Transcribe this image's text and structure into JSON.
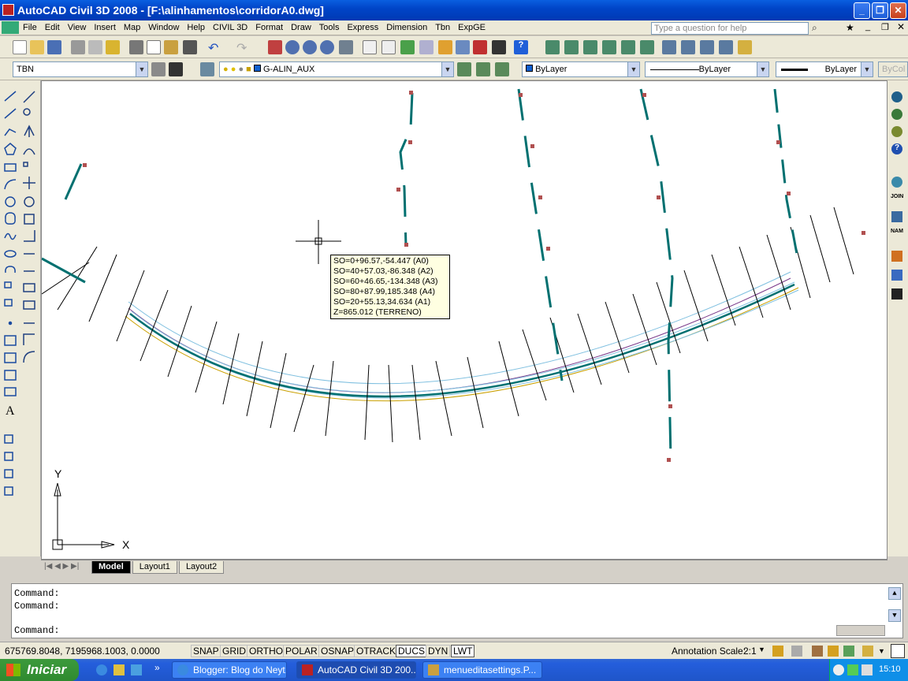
{
  "window": {
    "title": "AutoCAD Civil 3D 2008 - [F:\\alinhamentos\\corridorA0.dwg]"
  },
  "menu": [
    "File",
    "Edit",
    "View",
    "Insert",
    "Map",
    "Window",
    "Help",
    "CIVIL 3D",
    "Format",
    "Draw",
    "Tools",
    "Express",
    "Dimension",
    "Tbn",
    "ExpGE"
  ],
  "help_search": {
    "placeholder": "Type a question for help"
  },
  "properties_bar": {
    "textstyle": "TBN",
    "layer": "G-ALIN_AUX",
    "color": "ByLayer",
    "linetype": "ByLayer",
    "lineweight": "ByLayer",
    "plotstyle": "ByCol"
  },
  "tooltip": {
    "lines": [
      "SO=0+96.57,-54.447 (A0)",
      "SO=40+57.03,-86.348 (A2)",
      "SO=60+46.65,-134.348 (A3)",
      "SO=80+87.99,185.348 (A4)",
      "SO=20+55.13,34.634 (A1)",
      "Z=865.012 (TERRENO)"
    ]
  },
  "ucs": {
    "x_label": "X",
    "y_label": "Y"
  },
  "layout_tabs": [
    "Model",
    "Layout1",
    "Layout2"
  ],
  "command_lines": [
    "Command:",
    "Command:",
    "Command:"
  ],
  "status": {
    "coords": "675769.8048, 7195968.1003, 0.0000",
    "toggles": [
      "SNAP",
      "GRID",
      "ORTHO",
      "POLAR",
      "OSNAP",
      "OTRACK",
      "DUCS",
      "DYN",
      "LWT"
    ],
    "annotation_scale_label": "Annotation Scale:",
    "annotation_scale_value": "2:1"
  },
  "taskbar": {
    "start": "Iniciar",
    "tasks": [
      "Blogger: Blog do Neyt...",
      "AutoCAD Civil 3D 200...",
      "menueditasettings.P..."
    ],
    "clock": "15:10"
  },
  "colors": {
    "accent": "#0a5fe0",
    "alignment": "#007070",
    "station": "#b05050"
  }
}
